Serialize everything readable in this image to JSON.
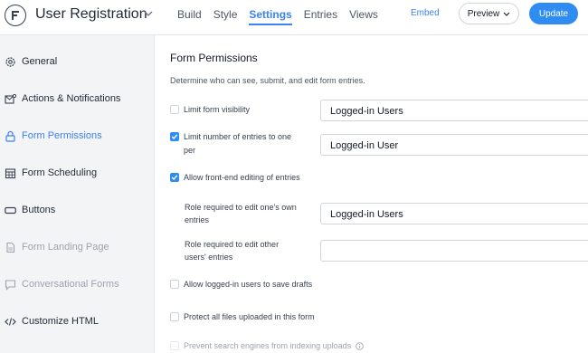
{
  "header": {
    "app_title": "User Registration",
    "tabs": [
      {
        "label": "Build",
        "active": false
      },
      {
        "label": "Style",
        "active": false
      },
      {
        "label": "Settings",
        "active": true
      },
      {
        "label": "Entries",
        "active": false
      },
      {
        "label": "Views",
        "active": false
      }
    ],
    "embed_label": "Embed",
    "preview_label": "Preview",
    "update_label": "Update",
    "accent_color": "#2f8cf0"
  },
  "sidebar": {
    "items": [
      {
        "label": "General",
        "icon": "gear-icon",
        "state": "normal"
      },
      {
        "label": "Actions & Notifications",
        "icon": "notifications-icon",
        "state": "normal"
      },
      {
        "label": "Form Permissions",
        "icon": "lock-icon",
        "state": "active"
      },
      {
        "label": "Form Scheduling",
        "icon": "calendar-icon",
        "state": "normal"
      },
      {
        "label": "Buttons",
        "icon": "button-icon",
        "state": "normal"
      },
      {
        "label": "Form Landing Page",
        "icon": "document-icon",
        "state": "muted"
      },
      {
        "label": "Conversational Forms",
        "icon": "chat-icon",
        "state": "muted"
      },
      {
        "label": "Customize HTML",
        "icon": "code-icon",
        "state": "normal"
      }
    ]
  },
  "main": {
    "title": "Form Permissions",
    "description": "Determine who can see, submit, and edit form entries.",
    "limit_visibility": {
      "label": "Limit form visibility",
      "checked": false,
      "value": "Logged-in Users"
    },
    "limit_entries": {
      "label_line1": "Limit number of entries to one",
      "label_line2": "per",
      "checked": true,
      "value": "Logged-in User"
    },
    "front_end_edit": {
      "label": "Allow front-end editing of entries",
      "checked": true
    },
    "role_own": {
      "label_line1": "Role required to edit one's own",
      "label_line2": "entries",
      "value": "Logged-in Users"
    },
    "role_other": {
      "label_line1": "Role required to edit other",
      "label_line2": "users' entries",
      "value": ""
    },
    "save_drafts": {
      "label": "Allow logged-in users to save drafts",
      "checked": false
    },
    "protect_files": {
      "label": "Protect all files uploaded in this form",
      "checked": false
    },
    "prevent_index": {
      "label": "Prevent search engines from indexing uploads",
      "checked": false
    }
  }
}
